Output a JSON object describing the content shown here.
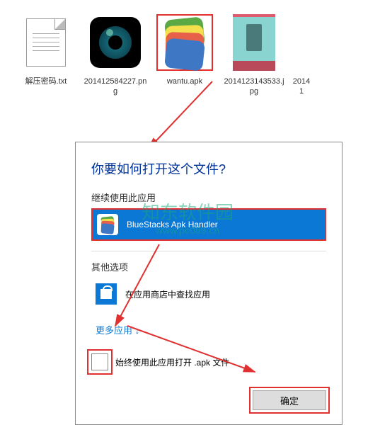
{
  "files": [
    {
      "name": "解压密码.txt",
      "type": "txt"
    },
    {
      "name": "201412584227.png",
      "type": "png"
    },
    {
      "name": "wantu.apk",
      "type": "apk",
      "highlighted": true
    },
    {
      "name": "2014123143533.jpg",
      "type": "jpg"
    },
    {
      "name": "20141",
      "type": "jpg2",
      "partial": true
    }
  ],
  "dialog": {
    "title": "你要如何打开这个文件?",
    "continue_label": "继续使用此应用",
    "selected_app": "BlueStacks Apk Handler",
    "other_label": "其他选项",
    "store_label": "在应用商店中查找应用",
    "more_apps": "更多应用 ↓",
    "always_label": "始终使用此应用打开 .apk 文件",
    "ok_label": "确定"
  },
  "watermark": {
    "main": "知东软件园",
    "sub": "www.pc089.cn"
  },
  "colors": {
    "accent": "#0a78d4",
    "highlight": "#e03030"
  }
}
